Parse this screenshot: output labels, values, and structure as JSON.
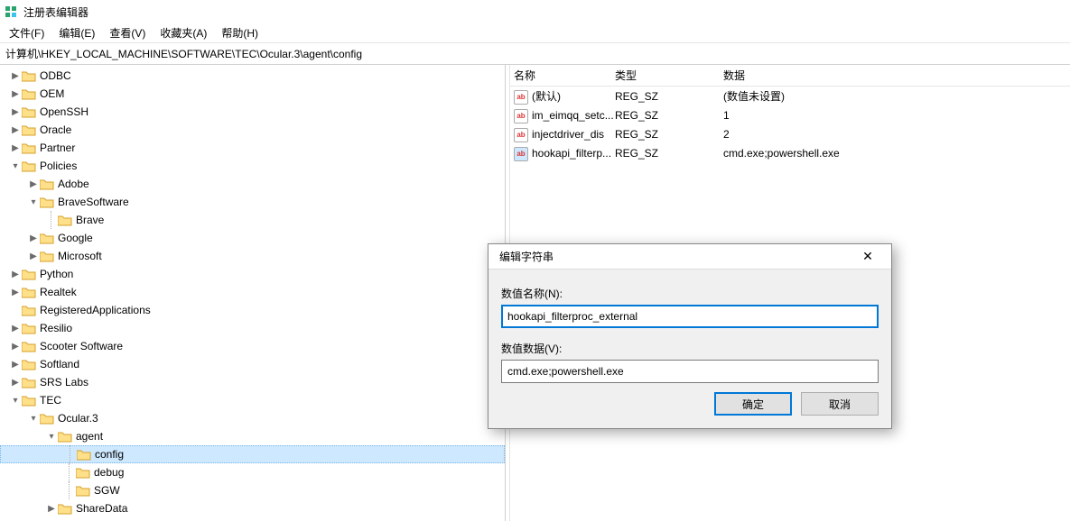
{
  "window": {
    "title": "注册表编辑器"
  },
  "menus": {
    "file": "文件(F)",
    "edit": "编辑(E)",
    "view": "查看(V)",
    "favorites": "收藏夹(A)",
    "help": "帮助(H)"
  },
  "address": "计算机\\HKEY_LOCAL_MACHINE\\SOFTWARE\\TEC\\Ocular.3\\agent\\config",
  "tree": {
    "odbc": "ODBC",
    "oem": "OEM",
    "openssh": "OpenSSH",
    "oracle": "Oracle",
    "partner": "Partner",
    "policies": "Policies",
    "adobe": "Adobe",
    "bravesoftware": "BraveSoftware",
    "brave": "Brave",
    "google": "Google",
    "microsoft": "Microsoft",
    "python": "Python",
    "realtek": "Realtek",
    "registeredapps": "RegisteredApplications",
    "resilio": "Resilio",
    "scooter": "Scooter Software",
    "softland": "Softland",
    "srslabs": "SRS Labs",
    "tec": "TEC",
    "ocular3": "Ocular.3",
    "agent": "agent",
    "config": "config",
    "debug": "debug",
    "sgw": "SGW",
    "sharedata": "ShareData"
  },
  "list": {
    "headers": {
      "name": "名称",
      "type": "类型",
      "data": "数据"
    },
    "rows": [
      {
        "name": "(默认)",
        "type": "REG_SZ",
        "data": "(数值未设置)",
        "selected": false
      },
      {
        "name": "im_eimqq_setc...",
        "type": "REG_SZ",
        "data": "1",
        "selected": false
      },
      {
        "name": "injectdriver_dis",
        "type": "REG_SZ",
        "data": "2",
        "selected": false
      },
      {
        "name": "hookapi_filterp...",
        "type": "REG_SZ",
        "data": "cmd.exe;powershell.exe",
        "selected": true
      }
    ]
  },
  "dialog": {
    "title": "编辑字符串",
    "name_label": "数值名称(N):",
    "name_value": "hookapi_filterproc_external",
    "data_label": "数值数据(V):",
    "data_value": "cmd.exe;powershell.exe",
    "ok": "确定",
    "cancel": "取消"
  }
}
